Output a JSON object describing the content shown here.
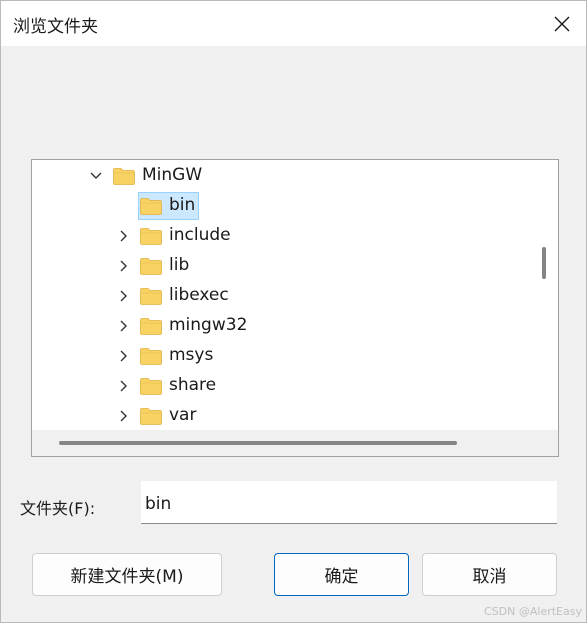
{
  "window": {
    "title": "浏览文件夹",
    "close_icon": "close-icon"
  },
  "tree": {
    "root": {
      "label": "MinGW",
      "expanded": true
    },
    "items": [
      {
        "label": "bin",
        "selected": true,
        "expandable": false
      },
      {
        "label": "include",
        "selected": false,
        "expandable": true
      },
      {
        "label": "lib",
        "selected": false,
        "expandable": true
      },
      {
        "label": "libexec",
        "selected": false,
        "expandable": true
      },
      {
        "label": "mingw32",
        "selected": false,
        "expandable": true
      },
      {
        "label": "msys",
        "selected": false,
        "expandable": true
      },
      {
        "label": "share",
        "selected": false,
        "expandable": true
      },
      {
        "label": "var",
        "selected": false,
        "expandable": true
      }
    ],
    "folder_icon": "folder-icon",
    "folder_color": "#f8d363"
  },
  "folder_field": {
    "label": "文件夹(F):",
    "value": "bin"
  },
  "buttons": {
    "new_folder": "新建文件夹(M)",
    "ok": "确定",
    "cancel": "取消"
  },
  "colors": {
    "accent": "#0067c0",
    "selection_bg": "#cce8ff",
    "selection_border": "#99d1ff"
  },
  "watermark": "CSDN @AlertEasy"
}
